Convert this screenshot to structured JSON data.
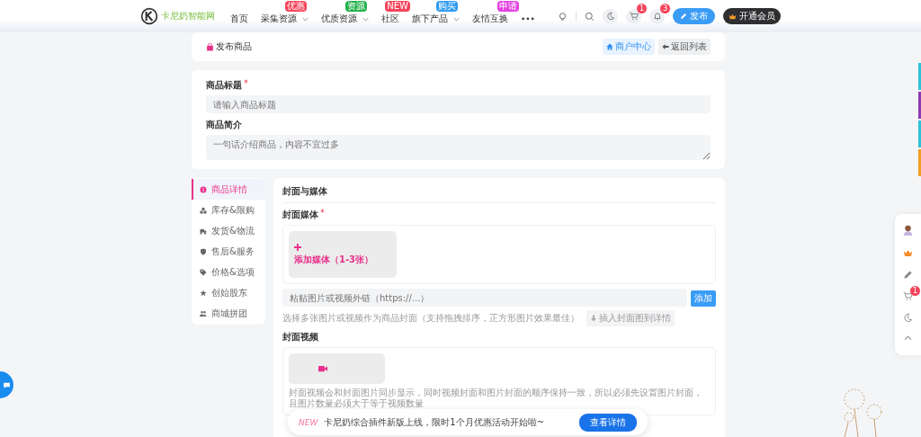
{
  "header": {
    "logo_text": "卡尼奶智能网",
    "nav": [
      {
        "label": "首页",
        "dropdown": false
      },
      {
        "label": "采集资源",
        "badge": "优惠",
        "color": "#f5455c",
        "dropdown": true
      },
      {
        "label": "优质资源",
        "badge": "资源",
        "color": "#22b14c",
        "dropdown": true
      },
      {
        "label": "社区",
        "badge": "NEW",
        "color": "#f5455c",
        "dropdown": false
      },
      {
        "label": "旗下产品",
        "badge": "购买",
        "color": "#2e9bf0",
        "dropdown": true
      },
      {
        "label": "友情互换",
        "badge": "申请",
        "color": "#e340e0",
        "dropdown": false
      }
    ],
    "more": "•••",
    "cart_count": "1",
    "notice_count": "3",
    "publish_button": "发布",
    "vip_button": "开通会员"
  },
  "top_card": {
    "title": "发布商品",
    "merchant_button": "商户中心",
    "back_button": "返回列表"
  },
  "basic": {
    "title_label": "商品标题",
    "title_required": true,
    "title_placeholder": "请输入商品标题",
    "intro_label": "商品简介",
    "intro_placeholder": "一句话介绍商品，内容不宜过多"
  },
  "sections": [
    {
      "label": "商品详情",
      "kind": "info",
      "selected": true
    },
    {
      "label": "库存&限购",
      "kind": "cubes",
      "selected": false
    },
    {
      "label": "发货&物流",
      "kind": "truck",
      "selected": false
    },
    {
      "label": "售后&服务",
      "kind": "shield",
      "selected": false
    },
    {
      "label": "价格&选项",
      "kind": "tag",
      "selected": false
    },
    {
      "label": "创始股东",
      "kind": "star",
      "selected": false
    },
    {
      "label": "商城拼团",
      "kind": "users",
      "selected": false
    }
  ],
  "media": {
    "heading": "封面与媒体",
    "cover_label": "封面媒体",
    "cover_required": true,
    "add_media": "添加媒体（1-3张）",
    "url_placeholder": "粘贴图片或视频外链（https://...）",
    "add_button": "添加",
    "hint": "选择多张图片或视频作为商品封面（支持拖拽排序，正方形图片效果最佳）",
    "insert_button": "插入封面图到详情",
    "video_label": "封面视频",
    "video_hint": "封面视频会和封面图片同步显示，同时视频封面和图片封面的顺序保持一致，所以必须先设置图片封面，且图片数量必须大于等于视频数量"
  },
  "notice": {
    "tag": "NEW",
    "text": "卡尼奶综合插件新版上线，限时1个月优惠活动开始啦~",
    "button": "查看详情"
  },
  "float_bar": {
    "cart_count": "1"
  }
}
